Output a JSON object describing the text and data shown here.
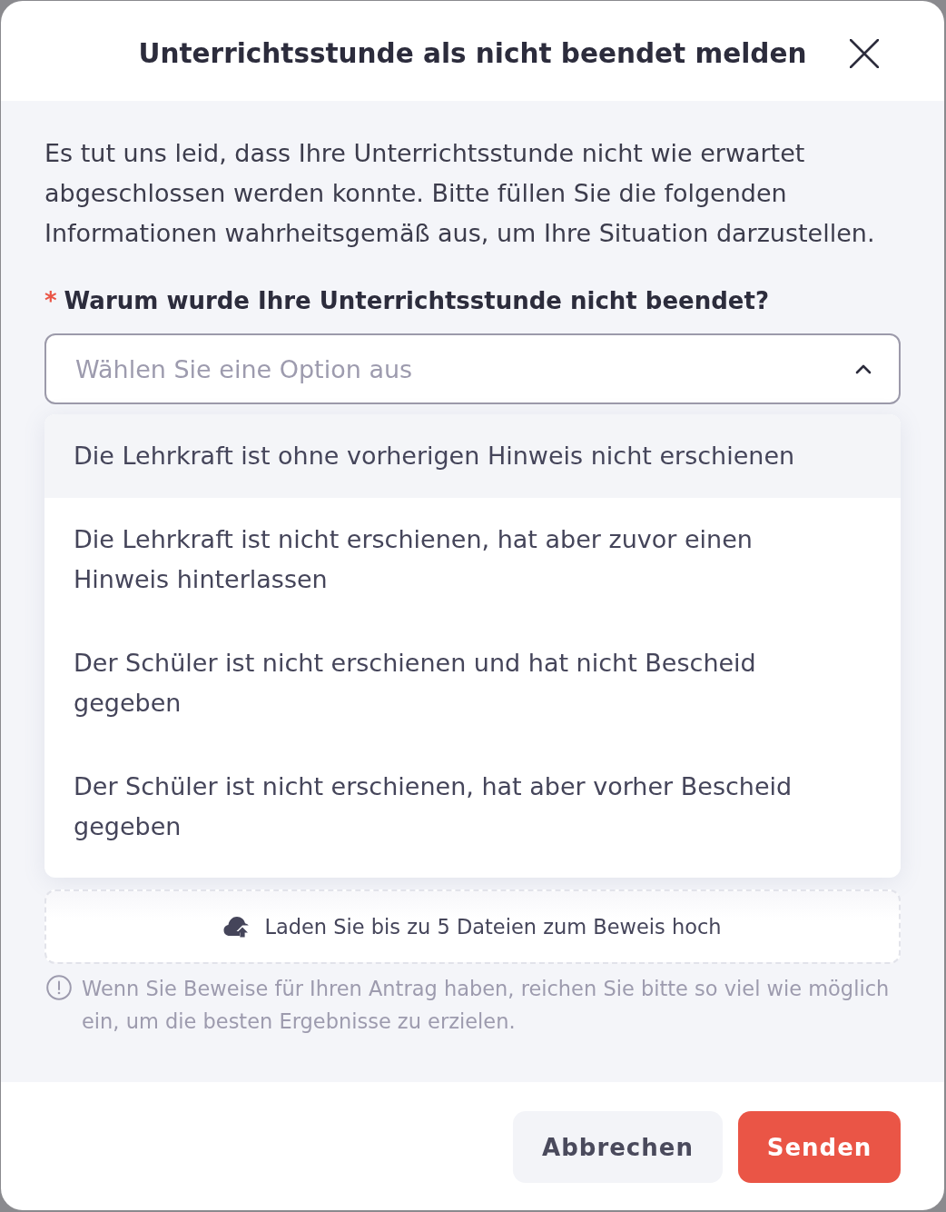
{
  "dialog": {
    "title": "Unterrichtsstunde als nicht beendet melden"
  },
  "intro": "Es tut uns leid, dass Ihre Unterrichtsstunde nicht wie erwartet abgeschlossen werden konnte. Bitte füllen Sie die folgenden Informationen wahrheitsgemäß aus, um Ihre Situation darzustellen.",
  "question": {
    "required_mark": "*",
    "label": "Warum wurde Ihre Unterrichtsstunde nicht beendet?"
  },
  "select": {
    "placeholder": "Wählen Sie eine Option aus",
    "expanded": true,
    "options": [
      {
        "label": "Die Lehrkraft ist ohne vorherigen Hinweis nicht erschienen",
        "highlighted": true
      },
      {
        "label": "Die Lehrkraft ist nicht erschienen, hat aber zuvor einen Hinweis hinterlassen",
        "highlighted": false
      },
      {
        "label": "Der Schüler ist nicht erschienen und hat nicht Bescheid gegeben",
        "highlighted": false
      },
      {
        "label": "Der Schüler ist nicht erschienen, hat aber vorher Bescheid gegeben",
        "highlighted": false
      }
    ]
  },
  "upload": {
    "label": "Laden Sie bis zu 5 Dateien zum Beweis hoch"
  },
  "hint": "Wenn Sie Beweise für Ihren Antrag haben, reichen Sie bitte so viel wie möglich ein, um die besten Ergebnisse zu erzielen.",
  "buttons": [
    {
      "label": "Abbrechen",
      "kind": "secondary"
    },
    {
      "label": "Senden",
      "kind": "primary"
    }
  ]
}
